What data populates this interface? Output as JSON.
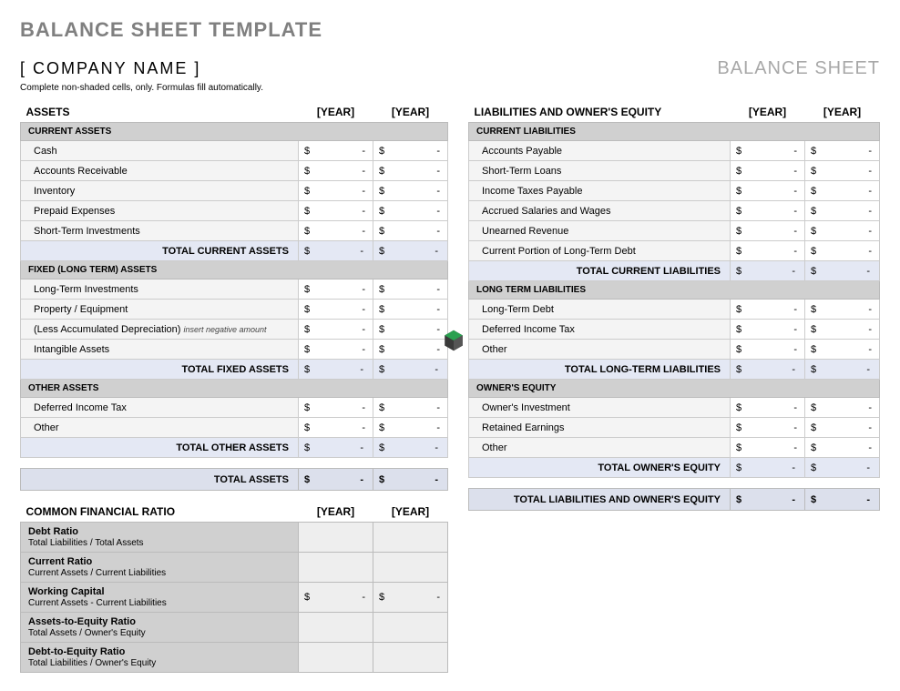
{
  "page_title": "BALANCE SHEET TEMPLATE",
  "company": "[ COMPANY NAME ]",
  "doc_title": "BALANCE SHEET",
  "instruction": "Complete non-shaded cells, only.  Formulas fill automatically.",
  "year1": "[YEAR]",
  "year2": "[YEAR]",
  "sym": "$",
  "dash": "-",
  "assets": {
    "title": "ASSETS",
    "current": {
      "label": "CURRENT ASSETS",
      "rows": [
        "Cash",
        "Accounts Receivable",
        "Inventory",
        "Prepaid Expenses",
        "Short-Term Investments"
      ],
      "total": "TOTAL CURRENT ASSETS"
    },
    "fixed": {
      "label": "FIXED (LONG TERM) ASSETS",
      "rows": [
        "Long-Term Investments",
        "Property / Equipment",
        "(Less Accumulated Depreciation)",
        "Intangible Assets"
      ],
      "note": "insert negative amount",
      "total": "TOTAL FIXED ASSETS"
    },
    "other": {
      "label": "OTHER ASSETS",
      "rows": [
        "Deferred Income Tax",
        "Other"
      ],
      "total": "TOTAL OTHER ASSETS"
    },
    "grand": "TOTAL ASSETS"
  },
  "liab": {
    "title": "LIABILITIES AND OWNER'S EQUITY",
    "current": {
      "label": "CURRENT LIABILITIES",
      "rows": [
        "Accounts Payable",
        "Short-Term Loans",
        "Income Taxes Payable",
        "Accrued Salaries and Wages",
        "Unearned Revenue",
        "Current Portion of Long-Term Debt"
      ],
      "total": "TOTAL CURRENT LIABILITIES"
    },
    "long": {
      "label": "LONG TERM LIABILITIES",
      "rows": [
        "Long-Term Debt",
        "Deferred Income Tax",
        "Other"
      ],
      "total": "TOTAL LONG-TERM LIABILITIES"
    },
    "equity": {
      "label": "OWNER'S EQUITY",
      "rows": [
        "Owner's Investment",
        "Retained Earnings",
        "Other"
      ],
      "total": "TOTAL OWNER'S EQUITY"
    },
    "grand": "TOTAL LIABILITIES AND OWNER'S EQUITY"
  },
  "ratios": {
    "title": "COMMON FINANCIAL RATIO",
    "items": [
      {
        "name": "Debt Ratio",
        "formula": "Total Liabilities / Total Assets",
        "money": false
      },
      {
        "name": "Current Ratio",
        "formula": "Current Assets / Current Liabilities",
        "money": false
      },
      {
        "name": "Working Capital",
        "formula": "Current Assets - Current Liabilities",
        "money": true
      },
      {
        "name": "Assets-to-Equity Ratio",
        "formula": "Total Assets / Owner's Equity",
        "money": false
      },
      {
        "name": "Debt-to-Equity Ratio",
        "formula": "Total Liabilities / Owner's Equity",
        "money": false
      }
    ]
  }
}
